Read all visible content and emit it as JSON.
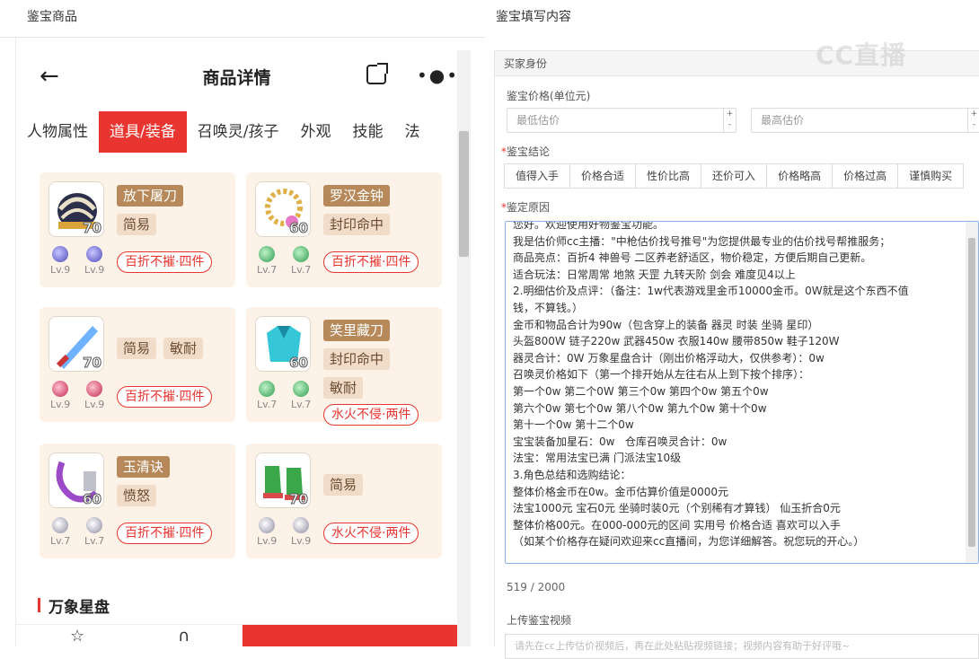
{
  "left_header": "鉴宝商品",
  "right_header": "鉴宝填写内容",
  "watermark": "CC直播",
  "phone": {
    "title": "商品详情",
    "tabs": [
      "人物属性",
      "道具/装备",
      "召唤灵/孩子",
      "外观",
      "技能",
      "法"
    ],
    "active_tab": "道具/装备",
    "items": [
      {
        "level": "70",
        "name": "放下屠刀",
        "tags": [
          "简易"
        ],
        "lv": [
          "Lv.9",
          "Lv.9"
        ],
        "badge": "百折不摧·四件"
      },
      {
        "level": "60",
        "name": "罗汉金钟",
        "tags": [
          "封印命中"
        ],
        "lv": [
          "Lv.7",
          "Lv.7"
        ],
        "badge": "百折不摧·四件"
      },
      {
        "level": "70",
        "name": "",
        "tags": [
          "简易",
          "敏耐"
        ],
        "lv": [
          "Lv.9",
          "Lv.9"
        ],
        "badge": "百折不摧·四件"
      },
      {
        "level": "60",
        "name": "笑里藏刀",
        "tags": [
          "封印命中",
          "敏耐"
        ],
        "lv": [
          "Lv.7",
          "Lv.7"
        ],
        "badge": "水火不侵·两件"
      },
      {
        "level": "60",
        "name": "玉清诀",
        "tags": [
          "愤怒"
        ],
        "lv": [
          "Lv.7",
          "Lv.7"
        ],
        "badge": "百折不摧·四件"
      },
      {
        "level": "70",
        "name": "",
        "tags": [
          "简易"
        ],
        "lv": [
          "Lv.9",
          "Lv.9"
        ],
        "badge": "水火不侵·两件"
      }
    ],
    "section_title": "万象星盘"
  },
  "form": {
    "section": "买家身份",
    "price_label": "鉴宝价格(单位元)",
    "min_placeholder": "最低估价",
    "max_placeholder": "最高估价",
    "conclusion_label": "鉴宝结论",
    "conclusions": [
      "值得入手",
      "价格合适",
      "性价比高",
      "还价可入",
      "价格略高",
      "价格过高",
      "谨慎购买"
    ],
    "reason_label": "鉴定原因",
    "reason_text": "您好。欢迎使用好物鉴宝功能。\n我是估价师cc主播：\"中枪估价找号推号\"为您提供最专业的估价找号帮推服务；\n商品亮点：百折4 神兽号 二区养老舒适区，物价稳定，方便后期自己更新。\n适合玩法：日常周常 地煞 天罡 九转天阶 剑会 难度见4以上\n2.明细估价及点评：（备注：1w代表游戏里金币10000金币。0W就是这个东西不值\n钱，不算钱。）\n金币和物品合计为90w（包含穿上的装备 器灵 时装 坐骑 星印）\n头盔800W 链子220w 武器450w 衣服140w 腰带850w 鞋子120W\n器灵合计：0W 万象星盘合计（刚出价格浮动大，仅供参考）：0w\n召唤灵价格如下（第一个排开始从左往右从上到下按个排序）：\n第一个0w 第二个0W 第三个0w 第四个0w 第五个0w\n第六个0w 第七个0w 第八个0w 第九个0w 第十个0w\n第十一个0w 第十二个0w\n宝宝装备加星石：0w   仓库召唤灵合计：0w\n法宝：常用法宝已满 门派法宝10级\n3.角色总结和选购结论：\n整体价格金币在0w。金币估算价值是0000元\n法宝1000元 宝石0元 坐骑时装0元（个别稀有才算钱） 仙玉折合0元\n整体价格00元。在000-000元的区间 实用号 价格合适 喜欢可以入手\n（如某个价格存在疑问欢迎来cc直播间，为您详细解答。祝您玩的开心。）",
    "char_count": "519 / 2000",
    "video_label": "上传鉴宝视频",
    "video_placeholder": "请先在cc上传估价视频后，再在此处粘贴视频链接；视频内容有助于好评哦~"
  }
}
